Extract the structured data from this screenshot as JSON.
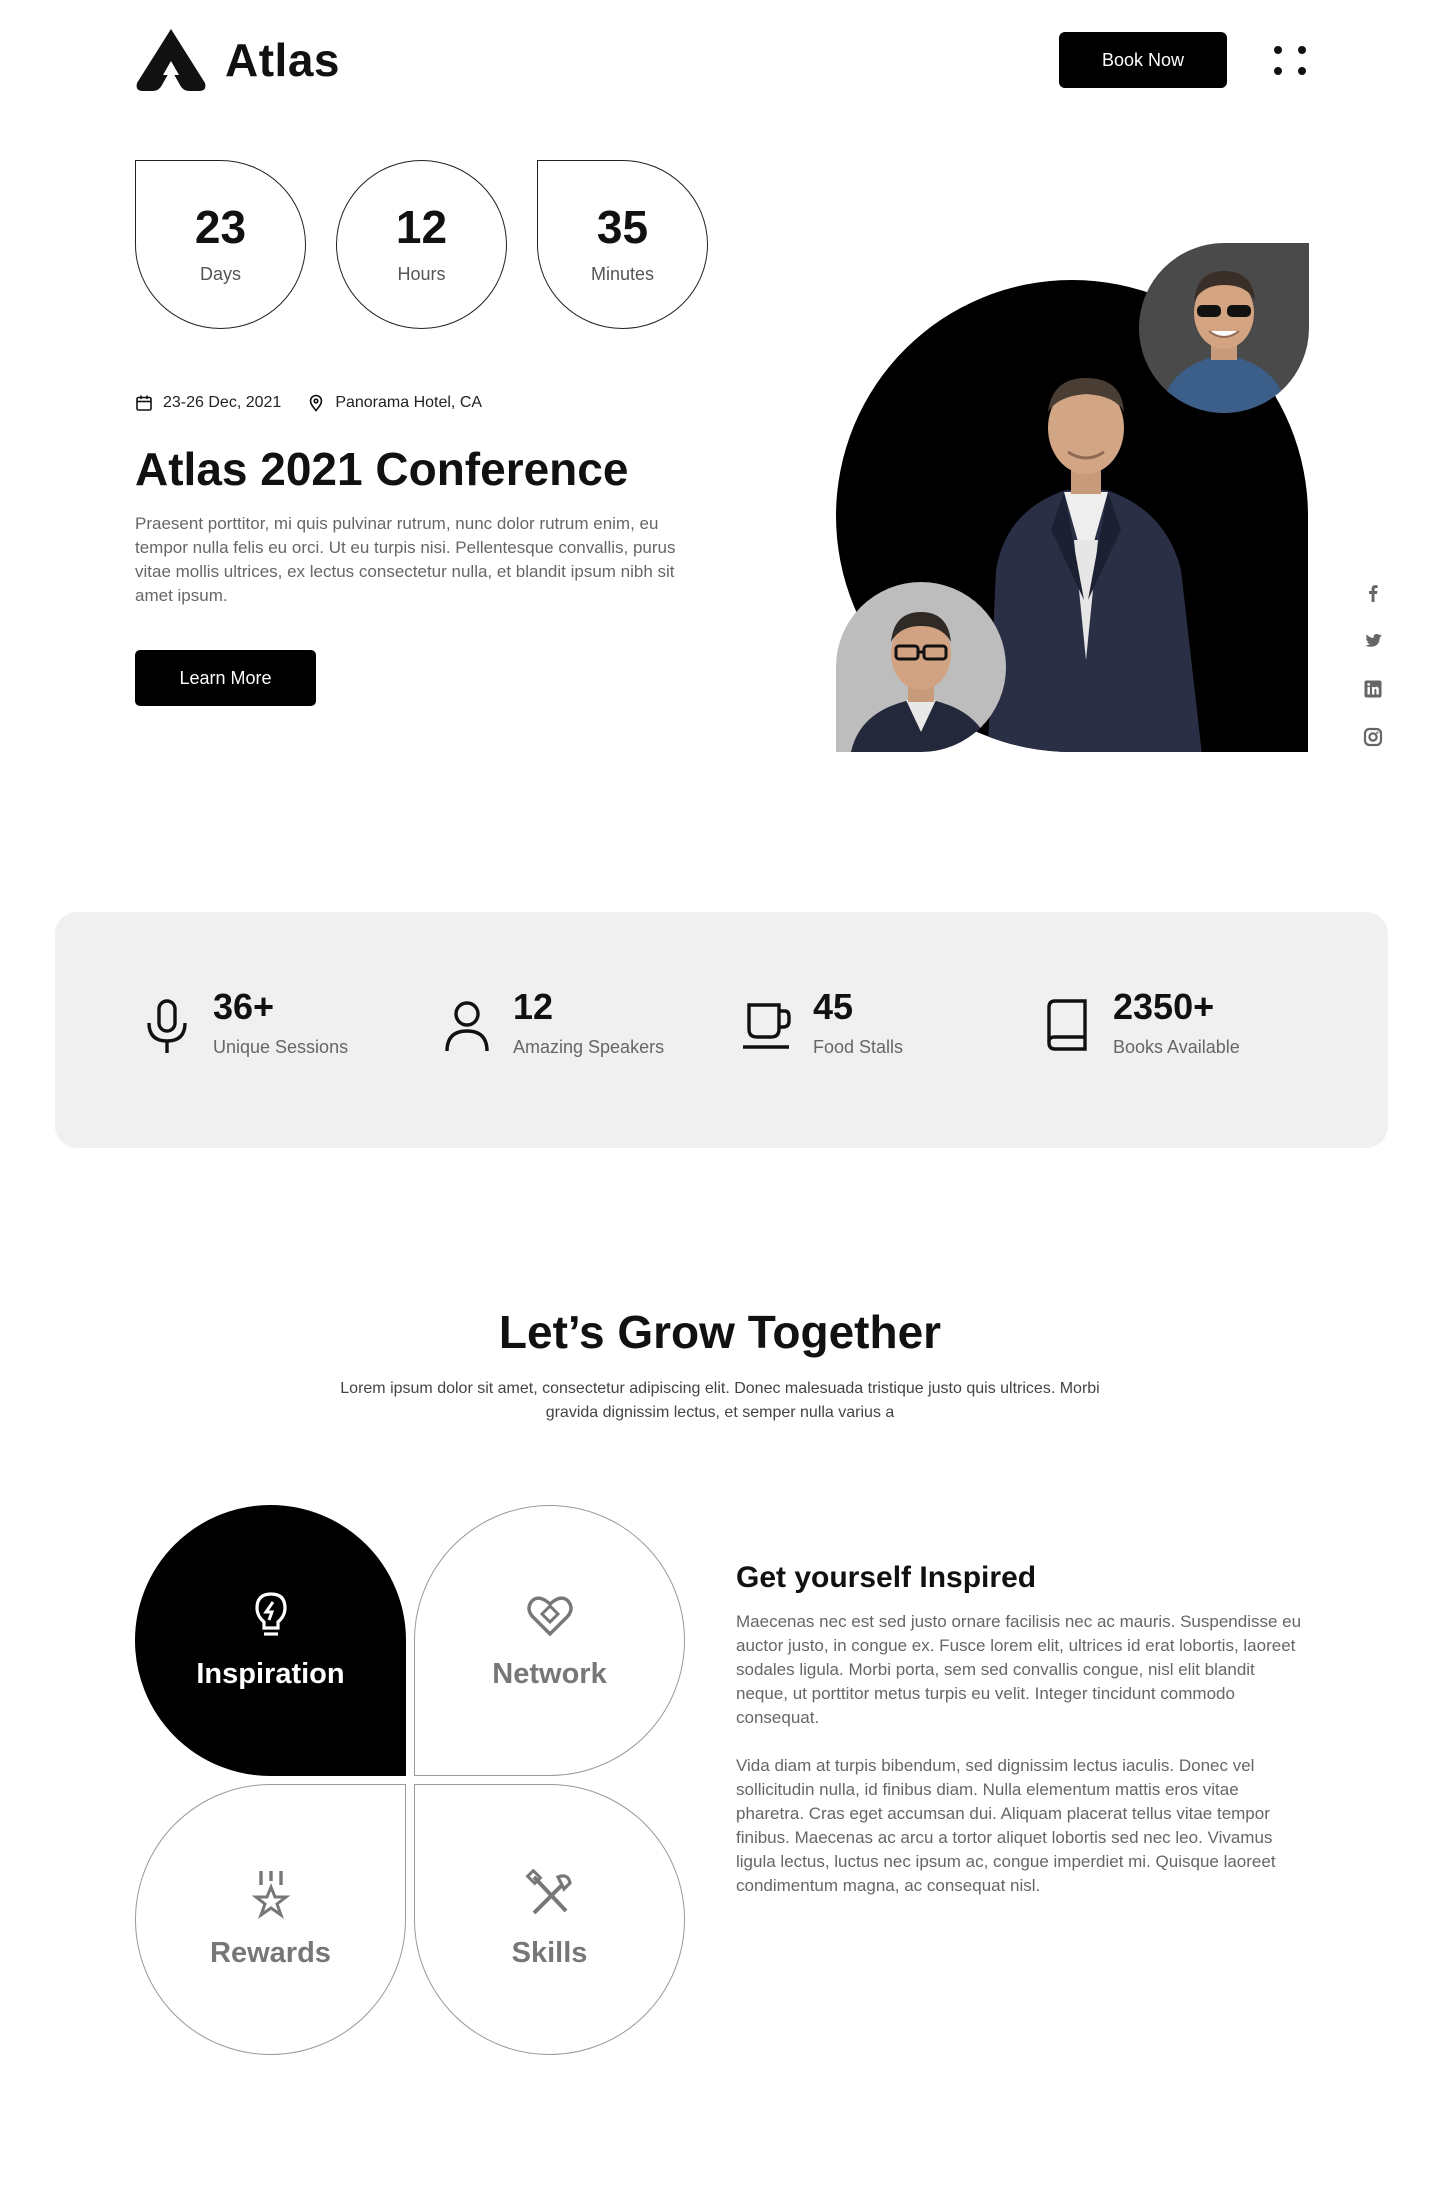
{
  "header": {
    "brand": "Atlas",
    "book_label": "Book Now"
  },
  "countdown": [
    {
      "value": "23",
      "label": "Days"
    },
    {
      "value": "12",
      "label": "Hours"
    },
    {
      "value": "35",
      "label": "Minutes"
    }
  ],
  "event": {
    "date": "23-26 Dec, 2021",
    "location": "Panorama Hotel, CA",
    "title": "Atlas 2021 Conference",
    "description": "Praesent porttitor, mi quis pulvinar rutrum, nunc dolor rutrum enim, eu tempor nulla felis eu orci. Ut eu turpis nisi. Pellentesque convallis, purus vitae mollis ultrices, ex lectus consectetur nulla, et blandit ipsum nibh sit amet ipsum.",
    "cta_label": "Learn More"
  },
  "social": [
    "facebook-icon",
    "twitter-icon",
    "linkedin-icon",
    "instagram-icon"
  ],
  "stats": [
    {
      "value": "36+",
      "label": "Unique Sessions",
      "icon": "microphone-icon"
    },
    {
      "value": "12",
      "label": "Amazing Speakers",
      "icon": "user-icon"
    },
    {
      "value": "45",
      "label": "Food Stalls",
      "icon": "cup-icon"
    },
    {
      "value": "2350+",
      "label": "Books Available",
      "icon": "book-icon"
    }
  ],
  "grow": {
    "title": "Let’s Grow Together",
    "description": "Lorem ipsum dolor sit amet, consectetur adipiscing elit. Donec malesuada tristique justo quis ultrices. Morbi gravida dignissim lectus, et semper nulla varius a"
  },
  "features": [
    {
      "label": "Inspiration",
      "icon": "lightbulb-icon",
      "active": true
    },
    {
      "label": "Network",
      "icon": "heart-handshake-icon",
      "active": false
    },
    {
      "label": "Rewards",
      "icon": "medal-icon",
      "active": false
    },
    {
      "label": "Skills",
      "icon": "tools-icon",
      "active": false
    }
  ],
  "inspire": {
    "title": "Get yourself Inspired",
    "paragraph1": "Maecenas nec est sed justo ornare facilisis nec ac mauris. Suspendisse eu auctor justo, in congue ex. Fusce lorem elit, ultrices id erat lobortis, laoreet sodales ligula. Morbi porta, sem sed convallis congue, nisl elit blandit neque, ut porttitor metus turpis eu velit. Integer tincidunt commodo consequat.",
    "paragraph2": "Vida diam at turpis bibendum, sed dignissim lectus iaculis. Donec vel sollicitudin nulla, id finibus diam. Nulla elementum mattis eros vitae pharetra. Cras eget accumsan dui. Aliquam placerat tellus vitae tempor finibus. Maecenas ac arcu a tortor aliquet lobortis sed nec leo. Vivamus ligula lectus, luctus nec ipsum ac, congue imperdiet mi. Quisque laoreet condimentum magna, ac consequat nisl."
  }
}
